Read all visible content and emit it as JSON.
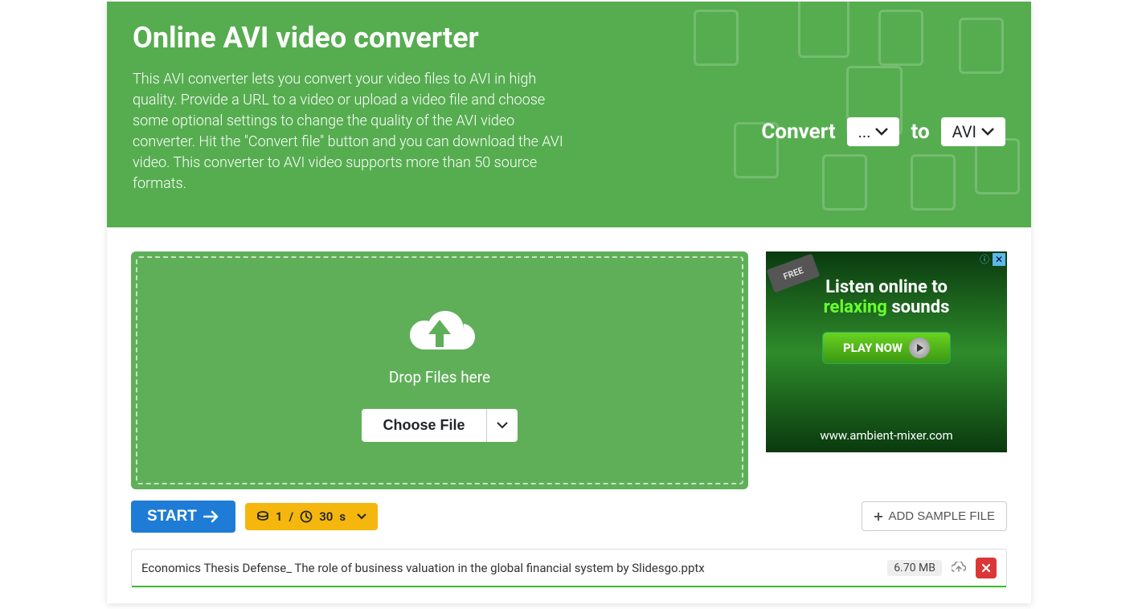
{
  "header": {
    "title": "Online AVI video converter",
    "description": "This AVI converter lets you convert your video files to AVI in high quality. Provide a URL to a video or upload a video file and choose some optional settings to change the quality of the AVI video converter. Hit the \"Convert file\" button and you can download the AVI video. This converter to AVI video supports more than 50 source formats.",
    "convert_label": "Convert",
    "from_value": "...",
    "to_label": "to",
    "to_value": "AVI"
  },
  "dropzone": {
    "drop_text": "Drop Files here",
    "choose_label": "Choose File"
  },
  "ad": {
    "tag": "FREE",
    "line1": "Listen online to",
    "relaxing": "relaxing",
    "sounds": " sounds",
    "play": "PLAY NOW",
    "url": "www.ambient-mixer.com"
  },
  "controls": {
    "start": "START",
    "count": "1",
    "sep": "/",
    "time_value": "30",
    "time_unit": "s",
    "add_sample": "ADD SAMPLE FILE"
  },
  "file": {
    "name": "Economics Thesis Defense_ The role of business valuation in the global financial system by Slidesgo.pptx",
    "size": "6.70 MB"
  }
}
